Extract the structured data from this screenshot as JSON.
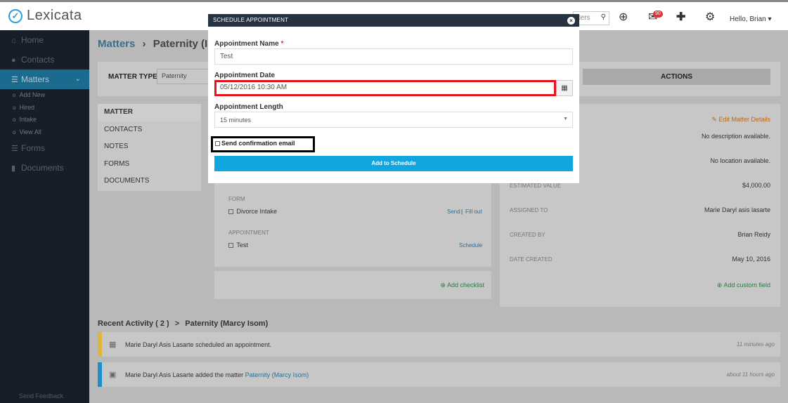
{
  "app": {
    "name": "Lexicata"
  },
  "topbar": {
    "search_text": "tters",
    "notification_count": "90",
    "greeting": "Hello, Brian"
  },
  "sidebar": {
    "items": [
      {
        "label": "Home",
        "icon": "home-icon"
      },
      {
        "label": "Contacts",
        "icon": "user-icon"
      },
      {
        "label": "Matters",
        "icon": "list-icon",
        "active": true
      },
      {
        "label": "Forms",
        "icon": "list-icon"
      },
      {
        "label": "Documents",
        "icon": "file-icon"
      }
    ],
    "matters_sub": [
      "Add New",
      "Hired",
      "Intake",
      "View All"
    ],
    "feedback": "Send Feedback"
  },
  "page": {
    "breadcrumb_root": "Matters",
    "breadcrumb_current": "Paternity (I",
    "matter_type_label": "MATTER TYPE",
    "matter_type_value": "Paternity",
    "actions_label": "ACTIONS",
    "left_nav": [
      "MATTER",
      "CONTACTS",
      "NOTES",
      "FORMS",
      "DOCUMENTS"
    ],
    "form_section_label": "FORM",
    "form_item": "Divorce Intake",
    "form_send": "Send",
    "form_sep": "|",
    "form_fill": "Fill out",
    "appointment_section_label": "APPOINTMENT",
    "appointment_item": "Test",
    "appointment_schedule": "Schedule",
    "add_checklist": "Add checklist",
    "edit_matter": "Edit Matter Details",
    "description": "No description available.",
    "location": "No location available.",
    "details": [
      {
        "label": "ESTIMATED VALUE",
        "value": "$4,000.00"
      },
      {
        "label": "ASSIGNED TO",
        "value": "Marie Daryl asis lasarte"
      },
      {
        "label": "CREATED BY",
        "value": "Brian Reidy"
      },
      {
        "label": "DATE CREATED",
        "value": "May 10, 2016"
      }
    ],
    "add_custom_field": "Add custom field"
  },
  "recent_activity": {
    "title": "Recent Activity ( 2 )",
    "separator": ">",
    "subject": "Paternity (Marcy Isom)",
    "items": [
      {
        "text": "Marie Daryl Asis Lasarte scheduled an appointment.",
        "link": "",
        "time": "11 minutes ago",
        "bar_color": "#e0b63a"
      },
      {
        "text": "Marie Daryl Asis Lasarte added the matter ",
        "link": "Paternity (Marcy Isom)",
        "time": "about 11 hours ago",
        "bar_color": "#1d8fc6"
      }
    ]
  },
  "modal": {
    "title": "SCHEDULE APPOINTMENT",
    "name_label": "Appointment Name",
    "required_mark": "*",
    "name_value": "Test",
    "date_label": "Appointment Date",
    "date_value": "05/12/2016 10:30 AM",
    "length_label": "Appointment Length",
    "length_value": "15 minutes",
    "confirm_label": "Send confirmation email",
    "submit_label": "Add to Schedule"
  },
  "colors": {
    "accent": "#11a6e0",
    "sidebar_bg": "#181e27",
    "modal_header": "#263240",
    "highlight_red": "#e3161f"
  }
}
